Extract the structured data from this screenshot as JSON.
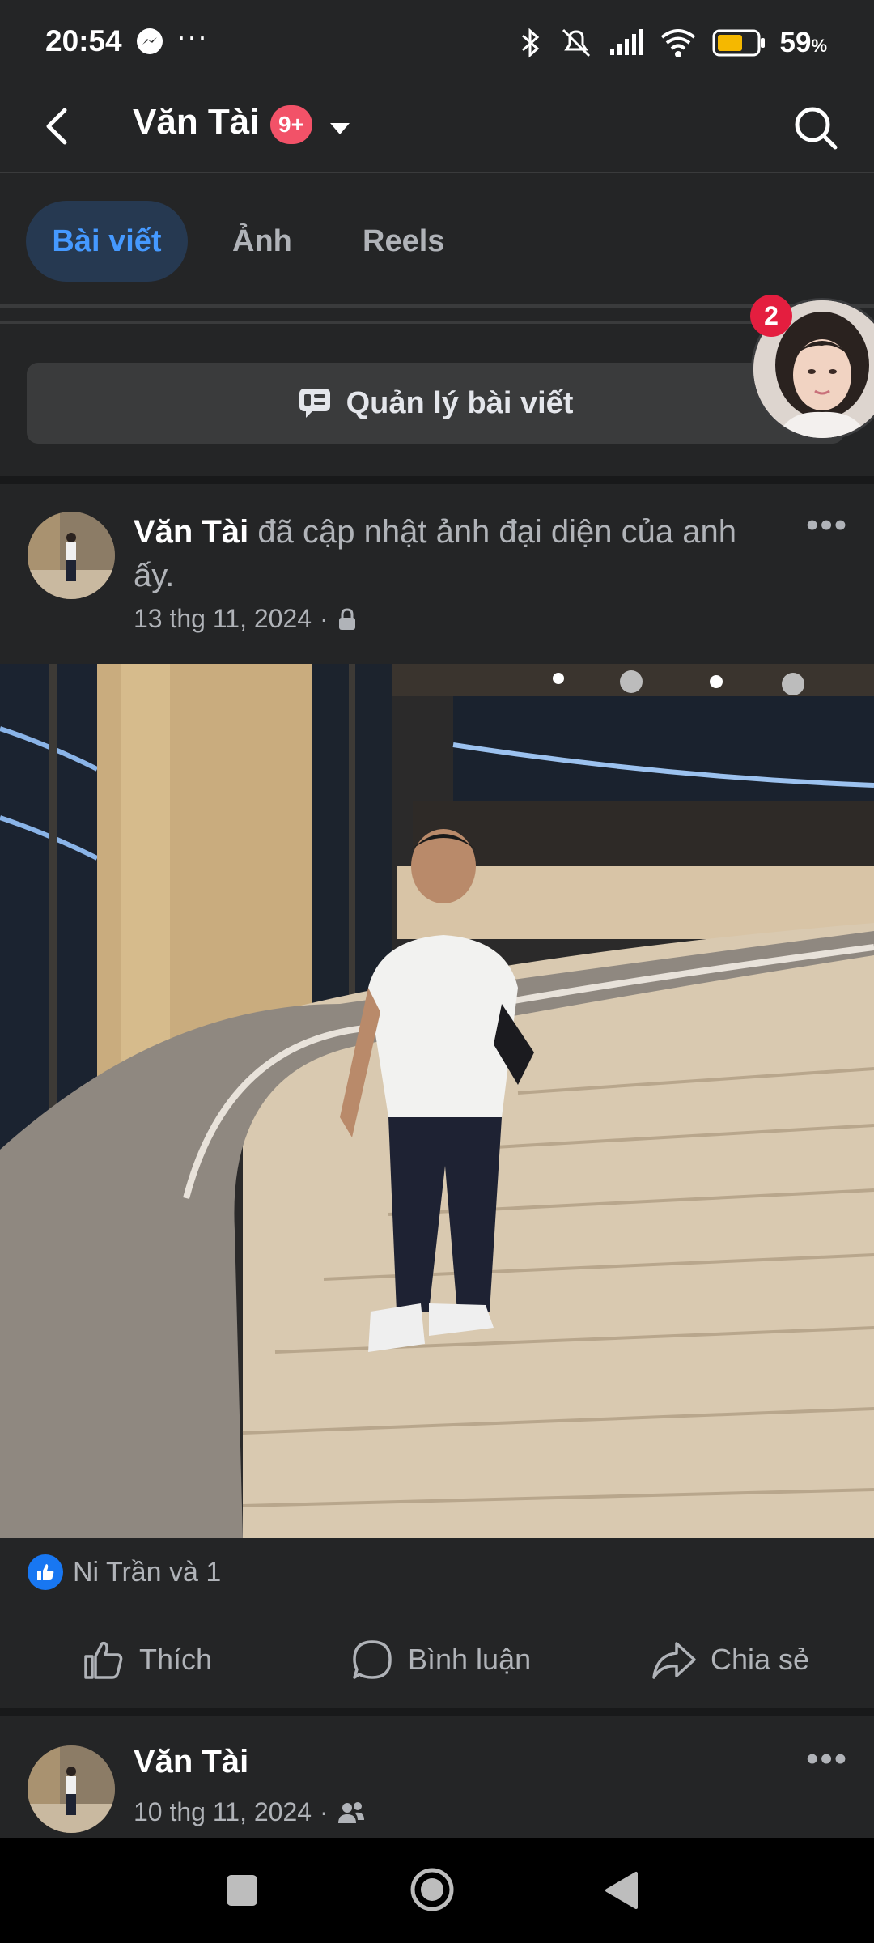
{
  "status_bar": {
    "time": "20:54",
    "more": "···",
    "battery_percent": "59",
    "battery_unit": "%",
    "icons": [
      "messenger-icon",
      "bluetooth-icon",
      "mute-icon",
      "signal-icon",
      "wifi-icon",
      "battery-icon"
    ]
  },
  "header": {
    "title": "Văn Tài",
    "badge": "9+"
  },
  "tabs": [
    {
      "label": "Bài viết",
      "active": true
    },
    {
      "label": "Ảnh",
      "active": false
    },
    {
      "label": "Reels",
      "active": false
    }
  ],
  "manage_posts_label": "Quản lý bài viết",
  "chat_head": {
    "badge": "2"
  },
  "post1": {
    "author": "Văn Tài",
    "action": "đã cập nhật ảnh đại diện của anh ấy.",
    "date": "13 thg 11, 2024",
    "separator": "·",
    "more": "•••"
  },
  "reactions": {
    "text": "Ni Trần và 1"
  },
  "actions": {
    "like": "Thích",
    "comment": "Bình luận",
    "share": "Chia sẻ"
  },
  "post2": {
    "author": "Văn Tài",
    "date": "10 thg 11, 2024",
    "separator": "·",
    "more": "•••"
  },
  "colors": {
    "background": "#242526",
    "accent": "#4599ff",
    "badge": "#f25268",
    "like_blue": "#1877f2"
  }
}
